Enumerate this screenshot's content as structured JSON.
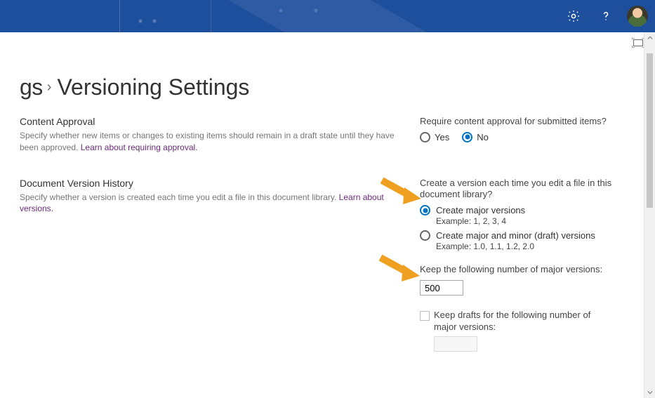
{
  "breadcrumb": {
    "prev_fragment": "gs",
    "current": "Versioning Settings"
  },
  "sections": {
    "approval": {
      "heading": "Content Approval",
      "desc_before_link": "Specify whether new items or changes to existing items should remain in a draft state until they have been approved.  ",
      "link": "Learn about requiring approval",
      "question": "Require content approval for submitted items?",
      "opt_yes": "Yes",
      "opt_no": "No",
      "selected": "no"
    },
    "history": {
      "heading": "Document Version History",
      "desc_before_link": "Specify whether a version is created each time you edit a file in this document library.  ",
      "link": "Learn about versions",
      "question": "Create a version each time you edit a file in this document library?",
      "opt_major_label": "Create major versions",
      "opt_major_example": "Example: 1, 2, 3, 4",
      "opt_minor_label": "Create major and minor (draft) versions",
      "opt_minor_example": "Example: 1.0, 1.1, 1.2, 2.0",
      "selected": "major",
      "keep_major_label": "Keep the following number of major versions:",
      "keep_major_value": "500",
      "keep_drafts_label": "Keep drafts for the following number of major versions:"
    }
  },
  "colors": {
    "accent": "#0072c6",
    "link": "#6b2a7a",
    "arrow": "#f0a020"
  }
}
